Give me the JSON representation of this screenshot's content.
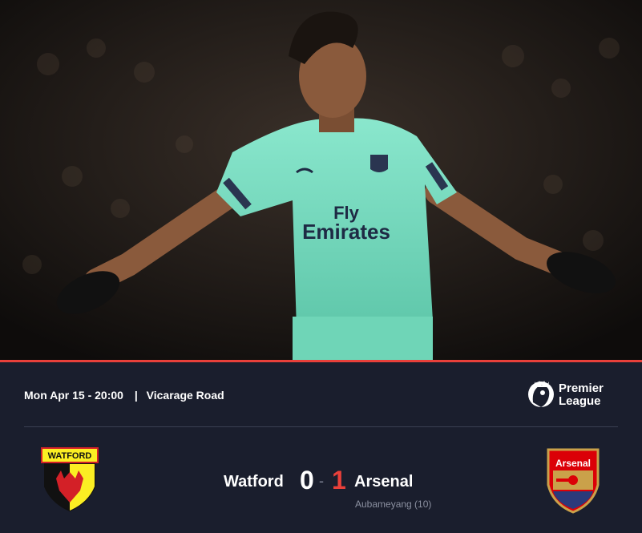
{
  "hero": {
    "image_description": "player-celebration-photo",
    "shirt_sponsor_line1": "Fly",
    "shirt_sponsor_line2": "Emirates"
  },
  "match": {
    "date_time": "Mon Apr 15 - 20:00",
    "separator": "|",
    "venue": "Vicarage Road",
    "competition": {
      "line1": "Premier",
      "line2": "League"
    },
    "home": {
      "name": "Watford",
      "score": "0",
      "crest_text": "WATFORD"
    },
    "away": {
      "name": "Arsenal",
      "score": "1",
      "crest_text": "Arsenal"
    },
    "dash": "-",
    "scorers_away": "Aubameyang (10)"
  },
  "colors": {
    "accent": "#e8403a",
    "panel_bg": "#1a1e2d",
    "shirt": "#7fe0c4"
  }
}
